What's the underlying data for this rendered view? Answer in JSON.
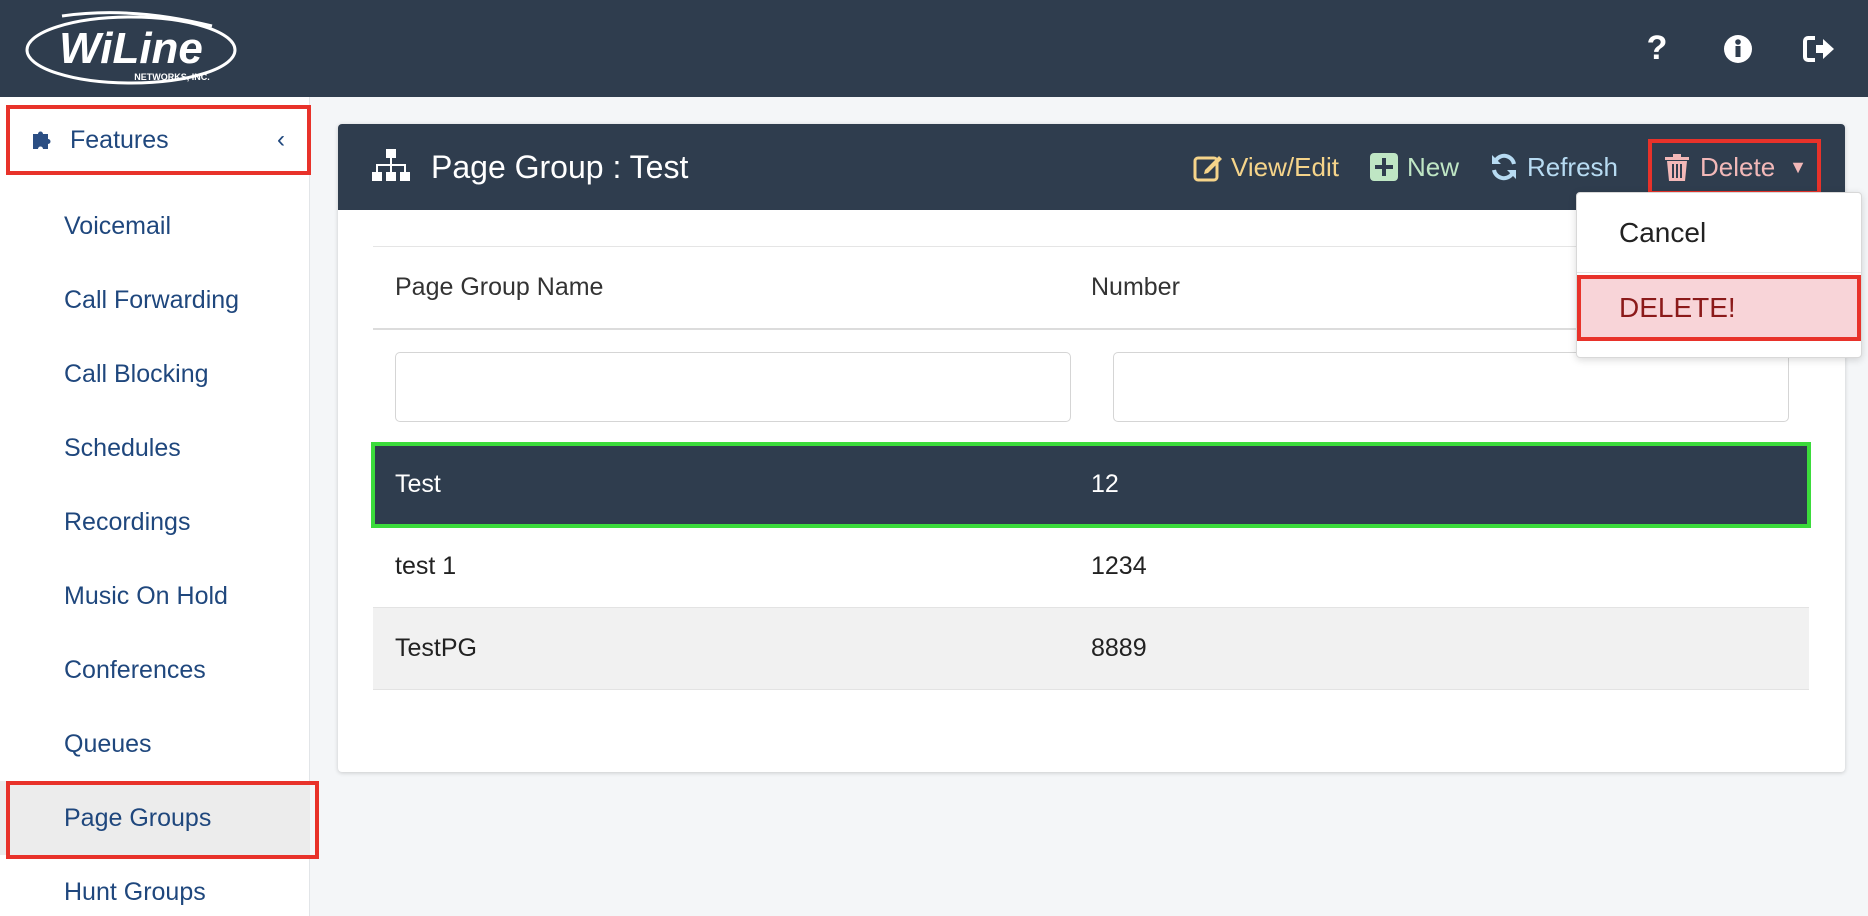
{
  "app": {
    "logo_text": "WiLine",
    "logo_subtext": "NETWORKS, INC."
  },
  "topbar": {
    "icons": [
      "help-icon",
      "info-icon",
      "logout-icon"
    ],
    "help_glyph": "?"
  },
  "sidebar": {
    "header": "Features",
    "items": [
      {
        "label": "Voicemail"
      },
      {
        "label": "Call Forwarding"
      },
      {
        "label": "Call Blocking"
      },
      {
        "label": "Schedules"
      },
      {
        "label": "Recordings"
      },
      {
        "label": "Music On Hold"
      },
      {
        "label": "Conferences"
      },
      {
        "label": "Queues"
      },
      {
        "label": "Page Groups"
      },
      {
        "label": "Hunt Groups"
      }
    ],
    "active": "Page Groups"
  },
  "panel": {
    "title": "Page Group : Test",
    "actions": {
      "view_edit": "View/Edit",
      "new": "New",
      "refresh": "Refresh",
      "delete": "Delete"
    }
  },
  "table": {
    "columns": [
      "Page Group Name",
      "Number"
    ],
    "filters": {
      "name": "",
      "number": ""
    },
    "rows": [
      {
        "name": "Test",
        "number": "12"
      },
      {
        "name": "test 1",
        "number": "1234"
      },
      {
        "name": "TestPG",
        "number": "8889"
      }
    ],
    "selected_row": 0
  },
  "delete_menu": {
    "cancel": "Cancel",
    "confirm": "DELETE!"
  },
  "colors": {
    "navbar": "#2f3d4e",
    "link": "#1f477d",
    "highlight_red": "#e8322a",
    "highlight_green": "#3bdb3b",
    "delete_bg": "#f8d4d8"
  }
}
